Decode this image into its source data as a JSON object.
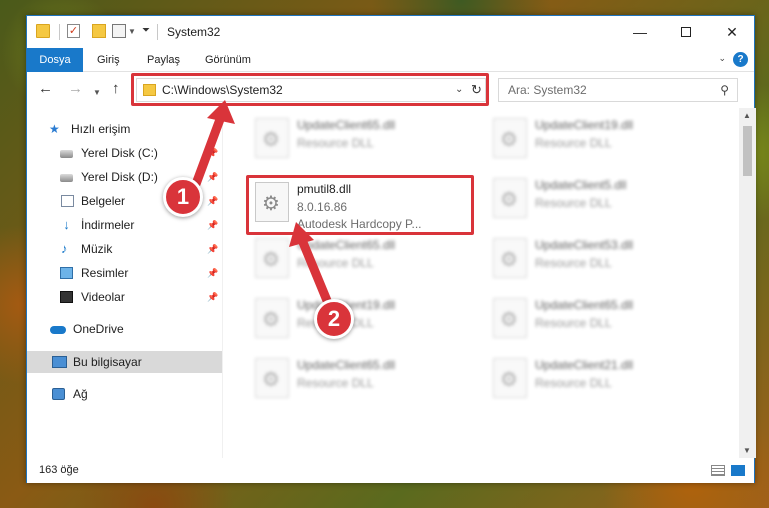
{
  "window": {
    "title": "System32"
  },
  "ribbon": {
    "tabs": [
      {
        "label": "Dosya"
      },
      {
        "label": "Giriş"
      },
      {
        "label": "Paylaş"
      },
      {
        "label": "Görünüm"
      }
    ],
    "help": "?"
  },
  "nav": {
    "address": "C:\\Windows\\System32",
    "search_placeholder": "Ara: System32"
  },
  "sidebar": {
    "items": [
      {
        "label": "Hızlı erişim",
        "icon": "star-icon"
      },
      {
        "label": "Yerel Disk (C:)",
        "icon": "disk-icon",
        "pinned": true
      },
      {
        "label": "Yerel Disk (D:)",
        "icon": "disk-icon",
        "pinned": true
      },
      {
        "label": "Belgeler",
        "icon": "documents-icon",
        "pinned": true
      },
      {
        "label": "İndirmeler",
        "icon": "download-icon",
        "pinned": true
      },
      {
        "label": "Müzik",
        "icon": "music-icon",
        "pinned": true
      },
      {
        "label": "Resimler",
        "icon": "pictures-icon",
        "pinned": true
      },
      {
        "label": "Videolar",
        "icon": "videos-icon",
        "pinned": true
      },
      {
        "label": "OneDrive",
        "icon": "onedrive-icon"
      },
      {
        "label": "Bu bilgisayar",
        "icon": "pc-icon",
        "selected": true
      },
      {
        "label": "Ağ",
        "icon": "network-icon"
      }
    ]
  },
  "files": {
    "featured": {
      "name": "pmutil8.dll",
      "version": "8.0.16.86",
      "description": "Autodesk Hardcopy P..."
    },
    "left_column": [
      {
        "name": "UpdateClient65.dll",
        "type": "Resource DLL"
      },
      {
        "name": "UpdateClient65.dll",
        "type": "Resource DLL"
      },
      {
        "name": "UpdateClient19.dll",
        "type": "Resource DLL"
      },
      {
        "name": "UpdateClient65.dll",
        "type": "Resource DLL"
      }
    ],
    "right_column": [
      {
        "name": "UpdateClient19.dll",
        "type": "Resource DLL"
      },
      {
        "name": "UpdateClient5.dll",
        "type": "Resource DLL"
      },
      {
        "name": "UpdateClient53.dll",
        "type": "Resource DLL"
      },
      {
        "name": "UpdateClient65.dll",
        "type": "Resource DLL"
      },
      {
        "name": "UpdateClient21.dll",
        "type": "Resource DLL"
      }
    ]
  },
  "status": {
    "item_count": "163 öğe"
  },
  "callouts": {
    "step1": "1",
    "step2": "2"
  },
  "colors": {
    "accent": "#1979ca",
    "highlight": "#d9343a"
  }
}
